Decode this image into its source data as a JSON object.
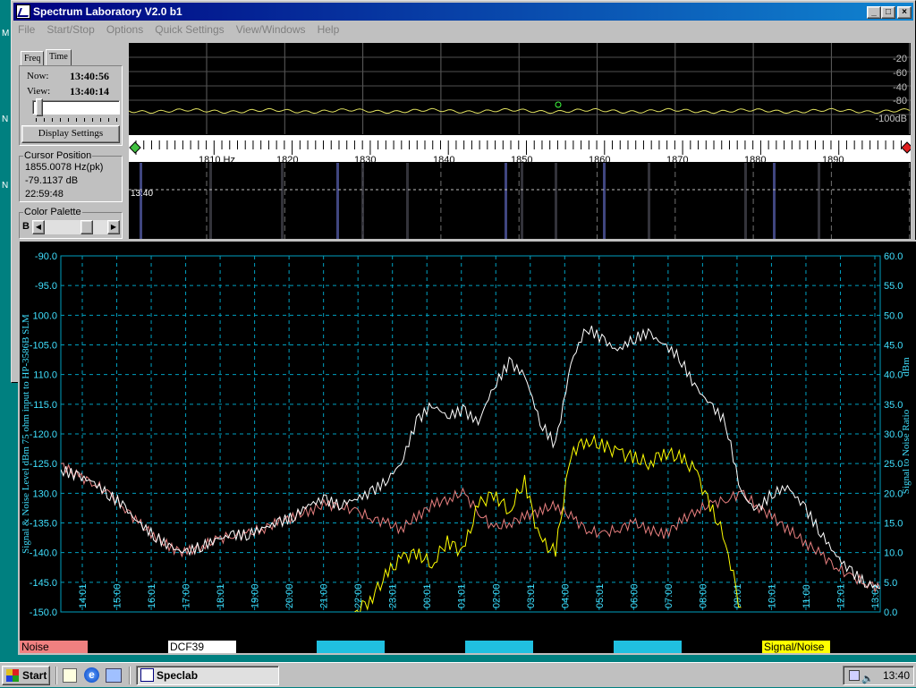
{
  "window": {
    "title": "Spectrum Laboratory V2.0 b1",
    "controls": [
      "_",
      "□",
      "×"
    ]
  },
  "desktop_edge_labels": [
    "M",
    "N",
    "N"
  ],
  "menu": [
    "File",
    "Start/Stop",
    "Options",
    "Quick Settings",
    "View/Windows",
    "Help"
  ],
  "left_panel": {
    "tabs": [
      "Freq",
      "Time"
    ],
    "now_label": "Now:",
    "now_value": "13:40:56",
    "view_label": "View:",
    "view_value": "13:40:14",
    "display_settings": "Display Settings",
    "cursor_title": "Cursor Position",
    "cursor_freq": "1855.0078 Hz(pk)",
    "cursor_level": "-79.1137 dB",
    "cursor_time": "22:59:48",
    "palette_title": "Color Palette",
    "palette_label": "B"
  },
  "spectrum": {
    "db_labels": [
      "-20",
      "-40",
      "-60",
      "-80",
      "-100dB"
    ],
    "freq_labels": [
      "1810 Hz",
      "1820",
      "1830",
      "1840",
      "1850",
      "1860",
      "1870",
      "1880",
      "1890"
    ],
    "waterfall_time": "13:40"
  },
  "chart_data": {
    "type": "line",
    "x_labels": [
      "14:01",
      "15:00",
      "16:01",
      "17:00",
      "18:01",
      "19:00",
      "20:00",
      "21:00",
      "22:00",
      "23:01",
      "00:01",
      "01:01",
      "02:00",
      "03:01",
      "04:00",
      "05:01",
      "06:00",
      "07:00",
      "08:00",
      "09:01",
      "10:01",
      "11:00",
      "12:01",
      "13:01"
    ],
    "ylabel_left": "Signal & Noise Level dBm 75 ohm input to HP-3586B SLM",
    "ylabel_right_1": "Signal to Noise Ratio",
    "ylabel_right_2": "dBm",
    "y_left_ticks": [
      "-90.0",
      "-95.0",
      "100.0",
      "-105.0",
      "110.0",
      "-115.0",
      "-120.0",
      "-125.0",
      "130.0",
      "-135.0",
      "-140.0",
      "-145.0",
      "-150.0"
    ],
    "y_right_ticks": [
      "60.0",
      "55.0",
      "50.0",
      "45.0",
      "40.0",
      "35.0",
      "30.0",
      "25.0",
      "20.0",
      "15.0",
      "10.0",
      "5.0",
      "0.0"
    ],
    "ylim_left": [
      -150,
      -90
    ],
    "ylim_right": [
      0,
      60
    ],
    "grid": true,
    "series": [
      {
        "name": "Noise",
        "color": "#e88080",
        "values": [
          -125,
          -127,
          -128,
          -130,
          -132,
          -135,
          -137,
          -139,
          -140,
          -139,
          -138,
          -137,
          -137,
          -136,
          -135,
          -134,
          -133,
          -132,
          -132,
          -133,
          -134,
          -135,
          -136,
          -134,
          -132,
          -131,
          -130,
          -133,
          -136,
          -135,
          -134,
          -133,
          -132,
          -134,
          -136,
          -137,
          -136,
          -135,
          -136,
          -137,
          -135,
          -133,
          -132,
          -131,
          -130,
          -132,
          -134,
          -136,
          -138,
          -140,
          -142,
          -144,
          -145,
          -146
        ]
      },
      {
        "name": "DCF39",
        "color": "#ffffff",
        "values": [
          -126,
          -127,
          -128,
          -130,
          -132,
          -135,
          -137,
          -139,
          -140,
          -139,
          -138,
          -137,
          -137,
          -136,
          -135,
          -134,
          -132,
          -131,
          -132,
          -131,
          -130,
          -128,
          -125,
          -118,
          -115,
          -117,
          -116,
          -118,
          -112,
          -108,
          -110,
          -118,
          -122,
          -108,
          -102,
          -104,
          -106,
          -104,
          -103,
          -105,
          -107,
          -112,
          -115,
          -118,
          -130,
          -133,
          -130,
          -129,
          -132,
          -136,
          -140,
          -143,
          -145,
          -146
        ]
      },
      {
        "name": "Signal/Noise",
        "color": "#ffff00",
        "values": [
          null,
          null,
          null,
          null,
          null,
          null,
          null,
          null,
          null,
          null,
          null,
          null,
          null,
          null,
          null,
          null,
          null,
          null,
          null,
          0,
          2,
          6,
          9,
          10,
          8,
          12,
          10,
          18,
          20,
          17,
          22,
          12,
          10,
          27,
          29,
          28,
          27,
          26,
          25,
          27,
          26,
          24,
          18,
          12,
          0,
          null,
          null,
          null,
          null,
          null,
          null,
          null,
          null,
          null
        ]
      }
    ],
    "legend": [
      "Noise",
      "DCF39",
      "",
      "",
      "",
      "Signal/Noise"
    ],
    "legend_colors": [
      "#f08080",
      "#ffffff",
      "#20c0e0",
      "#20c0e0",
      "#20c0e0",
      "#ffff00"
    ]
  },
  "taskbar": {
    "start": "Start",
    "task": "Speclab",
    "clock": "13:40"
  }
}
